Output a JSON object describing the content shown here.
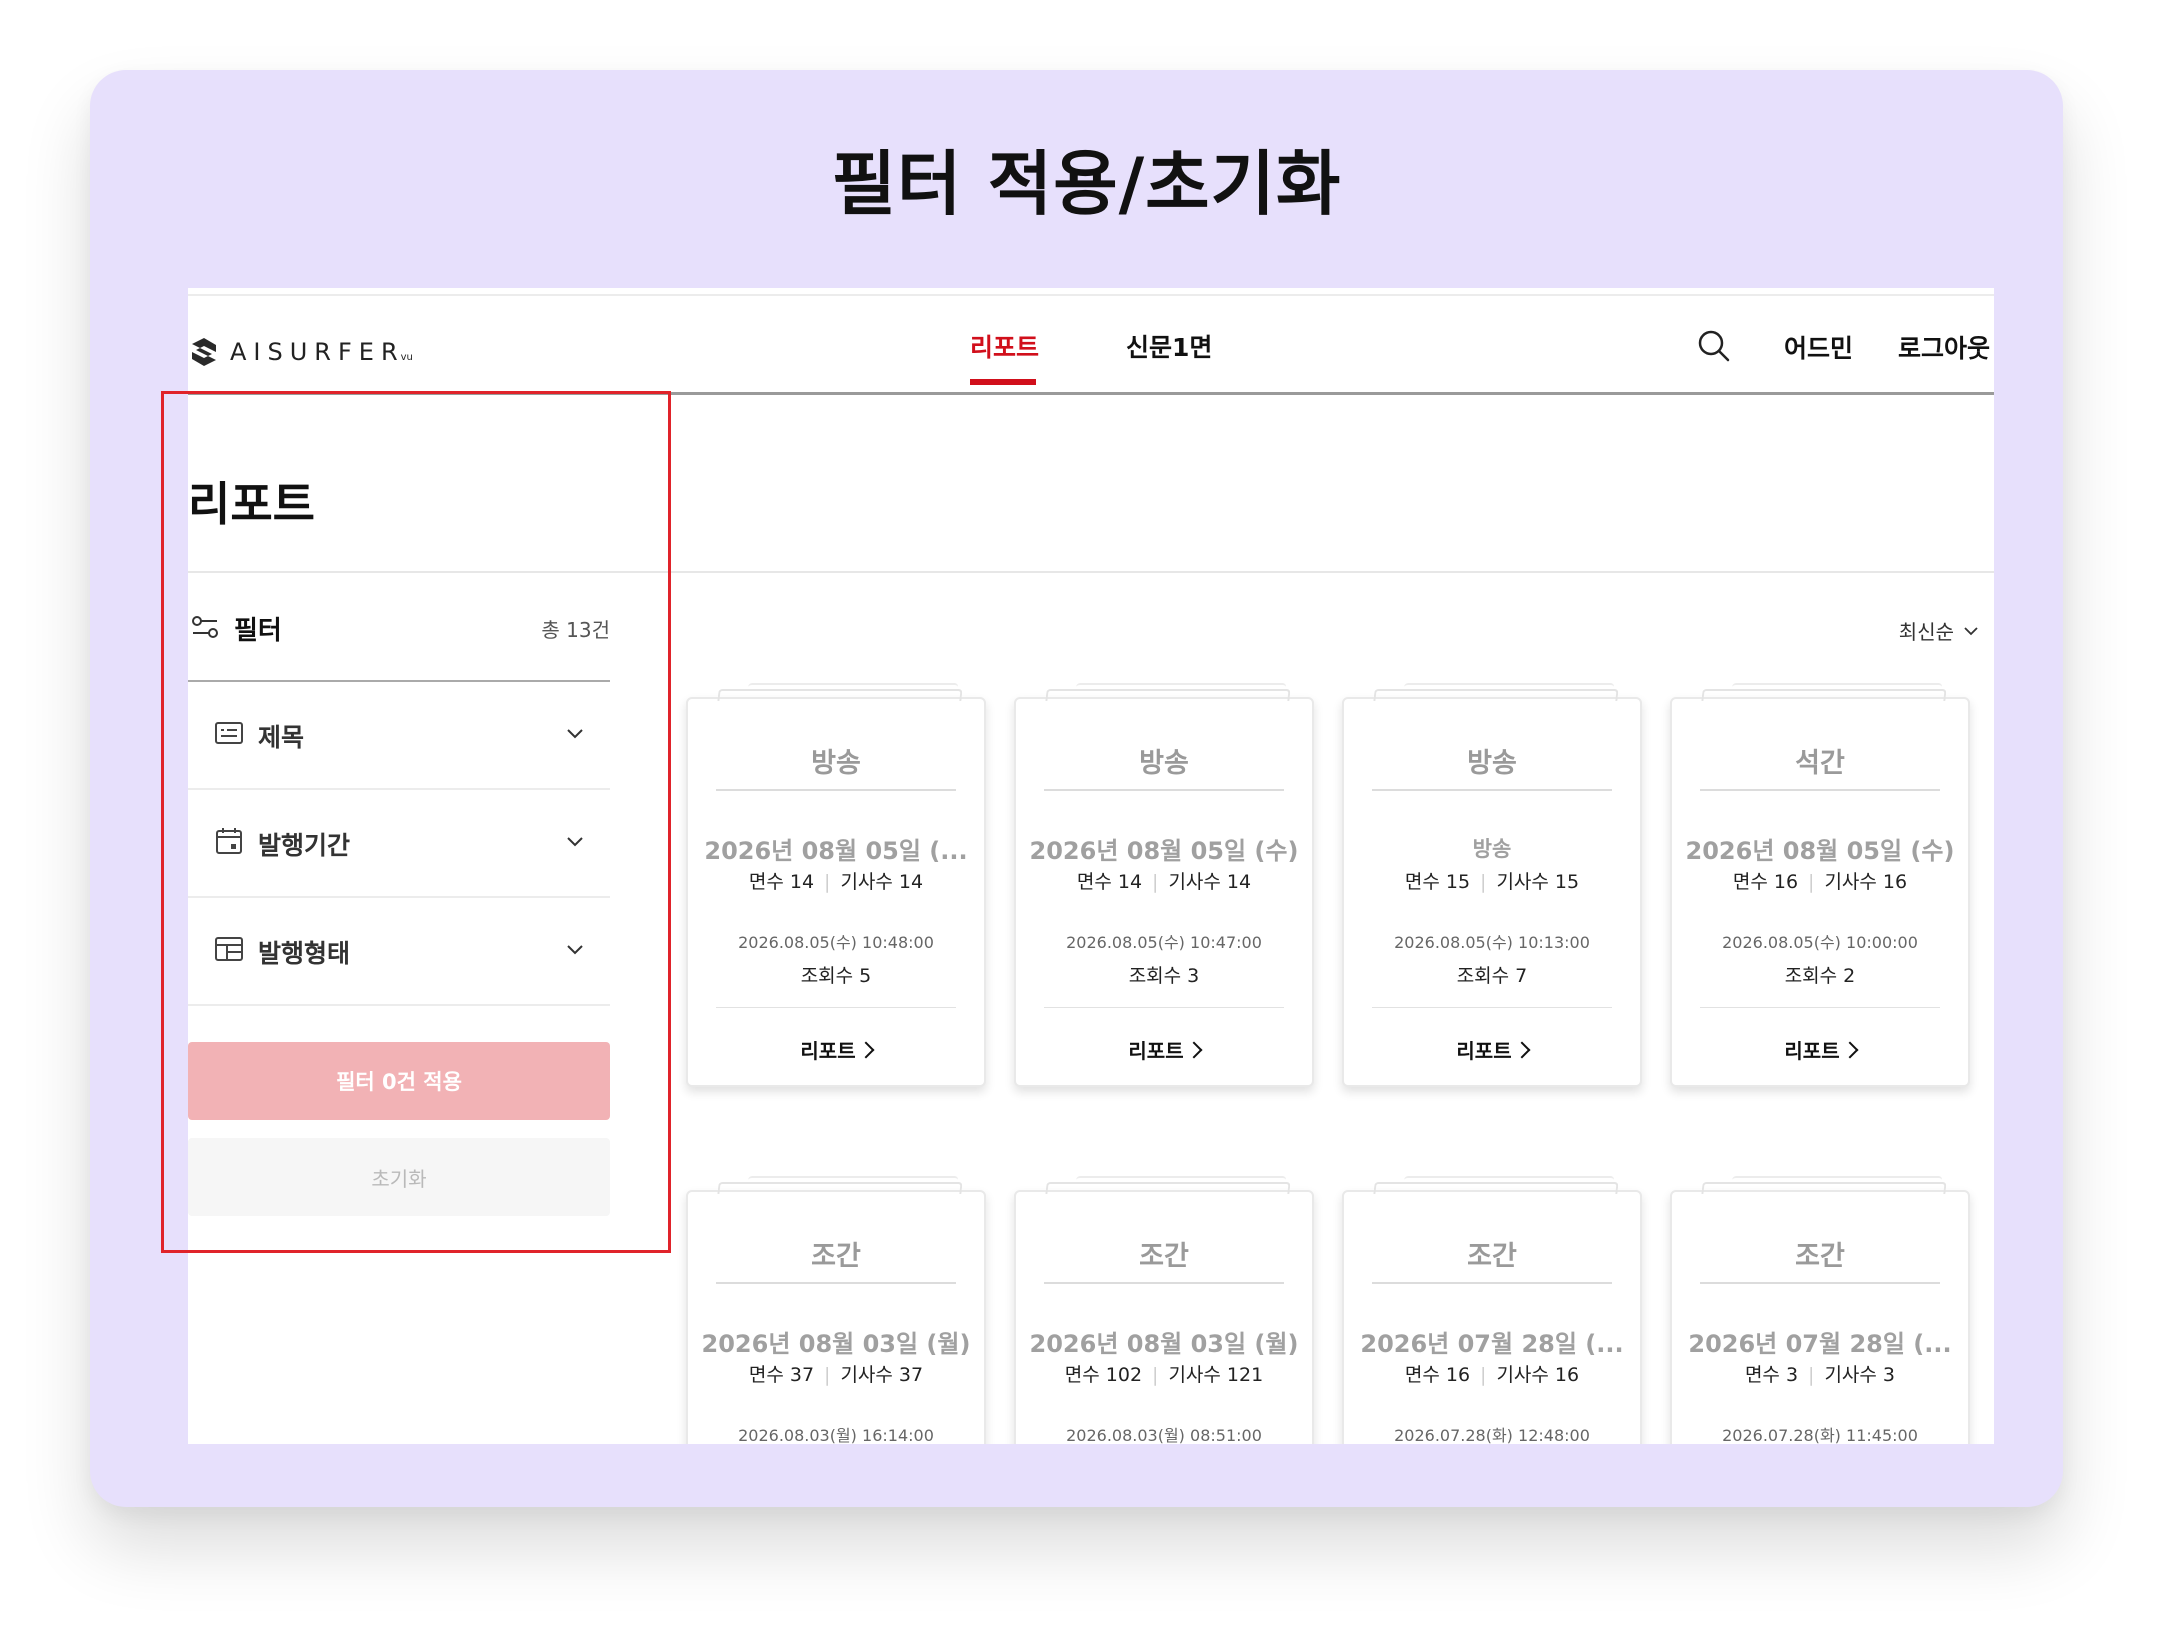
{
  "slide": {
    "title": "필터 적용/초기화"
  },
  "header": {
    "logo_text": "AISURFER",
    "logo_sub": "vu",
    "nav": [
      {
        "label": "리포트",
        "active": true
      },
      {
        "label": "신문1면",
        "active": false
      }
    ],
    "admin_label": "어드민",
    "logout_label": "로그아웃",
    "search_icon": "search-icon",
    "accent_color": "#d10f1b"
  },
  "page": {
    "title": "리포트"
  },
  "filter": {
    "label": "필터",
    "total": "총 13건",
    "sections": [
      {
        "label": "제목",
        "icon": "title-icon"
      },
      {
        "label": "발행기간",
        "icon": "calendar-icon"
      },
      {
        "label": "발행형태",
        "icon": "layout-icon"
      }
    ],
    "apply_label": "필터 0건 적용",
    "reset_label": "초기화",
    "apply_color": "#f2b2b5",
    "highlight_color": "#e0232a"
  },
  "sort": {
    "label": "최신순"
  },
  "cards": [
    {
      "category": "방송",
      "date": "2026년 08월 05일 (...",
      "pages": "면수 14",
      "articles": "기사수 14",
      "time": "2026.08.05(수) 10:48:00",
      "views": "조회수 5",
      "link": "리포트"
    },
    {
      "category": "방송",
      "date": "2026년 08월 05일 (수)",
      "pages": "면수 14",
      "articles": "기사수 14",
      "time": "2026.08.05(수) 10:47:00",
      "views": "조회수 3",
      "link": "리포트"
    },
    {
      "category": "방송",
      "date": "방송",
      "pages": "면수 15",
      "articles": "기사수 15",
      "time": "2026.08.05(수) 10:13:00",
      "views": "조회수 7",
      "link": "리포트"
    },
    {
      "category": "석간",
      "date": "2026년 08월 05일 (수)",
      "pages": "면수 16",
      "articles": "기사수 16",
      "time": "2026.08.05(수) 10:00:00",
      "views": "조회수 2",
      "link": "리포트"
    },
    {
      "category": "조간",
      "date": "2026년 08월 03일 (월)",
      "pages": "면수 37",
      "articles": "기사수 37",
      "time": "2026.08.03(월) 16:14:00",
      "views": "",
      "link": ""
    },
    {
      "category": "조간",
      "date": "2026년 08월 03일 (월)",
      "pages": "면수 102",
      "articles": "기사수 121",
      "time": "2026.08.03(월) 08:51:00",
      "views": "",
      "link": ""
    },
    {
      "category": "조간",
      "date": "2026년 07월 28일 (...",
      "pages": "면수 16",
      "articles": "기사수 16",
      "time": "2026.07.28(화) 12:48:00",
      "views": "",
      "link": ""
    },
    {
      "category": "조간",
      "date": "2026년 07월 28일 (...",
      "pages": "면수 3",
      "articles": "기사수 3",
      "time": "2026.07.28(화) 11:45:00",
      "views": "",
      "link": ""
    }
  ]
}
